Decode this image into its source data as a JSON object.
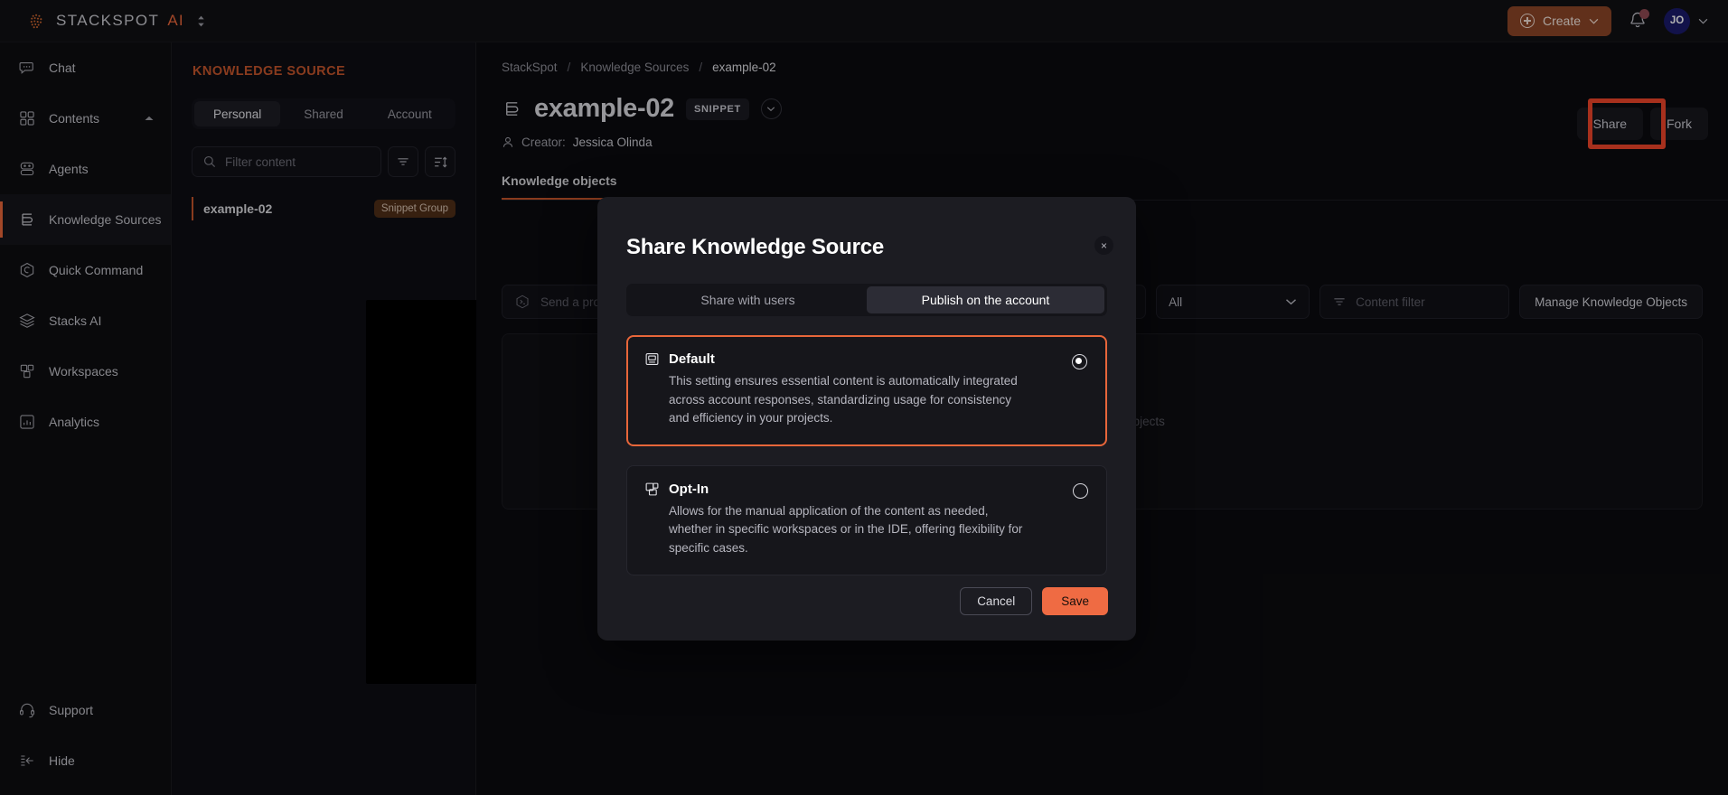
{
  "topbar": {
    "brand_name": "STACKSPOT",
    "brand_suffix": "AI",
    "brand_switch_icon": "chevron-updown-icon",
    "create_label": "Create",
    "create_caret": "⌄",
    "notifications_icon": "bell-icon",
    "avatar_initials": "JO",
    "avatar_caret": "⌄",
    "accent_color": "#e8663a",
    "create_bg": "#8c4527",
    "avatar_bg": "#1b1b6b"
  },
  "sidebar": {
    "items": [
      {
        "label": "Chat",
        "icon": "chat-bubble-icon",
        "active": false
      },
      {
        "label": "Contents",
        "icon": "grid-squares-icon",
        "active": false,
        "expanded": true
      },
      {
        "label": "Agents",
        "icon": "robot-icon",
        "active": false
      },
      {
        "label": "Knowledge Sources",
        "icon": "stacked-lines-icon",
        "active": true
      },
      {
        "label": "Quick Command",
        "icon": "hexagon-s-icon",
        "active": false
      },
      {
        "label": "Stacks AI",
        "icon": "layers-icon",
        "active": false
      },
      {
        "label": "Workspaces",
        "icon": "workspaces-icon",
        "active": false
      },
      {
        "label": "Analytics",
        "icon": "bar-chart-icon",
        "active": false
      }
    ],
    "bottom_items": [
      {
        "label": "Support",
        "icon": "headset-icon"
      },
      {
        "label": "Hide",
        "icon": "collapse-left-icon"
      }
    ]
  },
  "ks_panel": {
    "title": "KNOWLEDGE SOURCE",
    "tabs": [
      {
        "label": "Personal",
        "selected": true
      },
      {
        "label": "Shared",
        "selected": false
      },
      {
        "label": "Account",
        "selected": false
      }
    ],
    "filter_placeholder": "Filter content",
    "filter_value": "",
    "filter_icon": "search-icon",
    "filter_button_icon": "filter-icon",
    "sort_button_icon": "sort-icon",
    "list": [
      {
        "name": "example-02",
        "badge": "Snippet Group"
      }
    ]
  },
  "main": {
    "breadcrumb": [
      {
        "label": "StackSpot",
        "current": false
      },
      {
        "label": "Knowledge Sources",
        "current": false
      },
      {
        "label": "example-02",
        "current": true
      }
    ],
    "breadcrumb_separator": "/",
    "title": "example-02",
    "title_icon": "stacked-lines-icon",
    "chip": "SNIPPET",
    "title_caret": "⌄",
    "creator_label": "Creator:",
    "creator_name": "Jessica Olinda",
    "creator_icon": "person-icon",
    "tabs": [
      {
        "label": "Knowledge objects",
        "selected": true
      }
    ],
    "actions": [
      {
        "label": "Share",
        "highlighted": true
      },
      {
        "label": "Fork",
        "highlighted": false
      }
    ],
    "highlight_color": "#f0452a",
    "toolbar": {
      "prompt_placeholder": "Send a prompt",
      "prompt_icon": "terminal-icon",
      "select_value": "All",
      "select_caret": "⌄",
      "content_filter_placeholder": "Content filter",
      "content_filter_icon": "filter-icon",
      "manage_label": "Manage Knowledge Objects"
    },
    "content_placeholder": "Add knowledge objects"
  },
  "modal": {
    "title": "Share Knowledge Source",
    "close_icon": "close-icon",
    "close_glyph": "×",
    "tabs": [
      {
        "label": "Share with users",
        "selected": false
      },
      {
        "label": "Publish on the account",
        "selected": true
      }
    ],
    "options": [
      {
        "title": "Default",
        "icon": "default-card-icon",
        "description": "This setting ensures essential content is automatically integrated across account responses, standardizing usage for consistency and efficiency in your projects.",
        "selected": true
      },
      {
        "title": "Opt-In",
        "icon": "opt-in-icon",
        "description": "Allows for the manual application of the content as needed, whether in specific workspaces or in the IDE, offering flexibility for specific cases.",
        "selected": false
      }
    ],
    "cancel_label": "Cancel",
    "save_label": "Save",
    "selected_border_color": "#e8663a",
    "save_bg": "#ef6b43"
  }
}
